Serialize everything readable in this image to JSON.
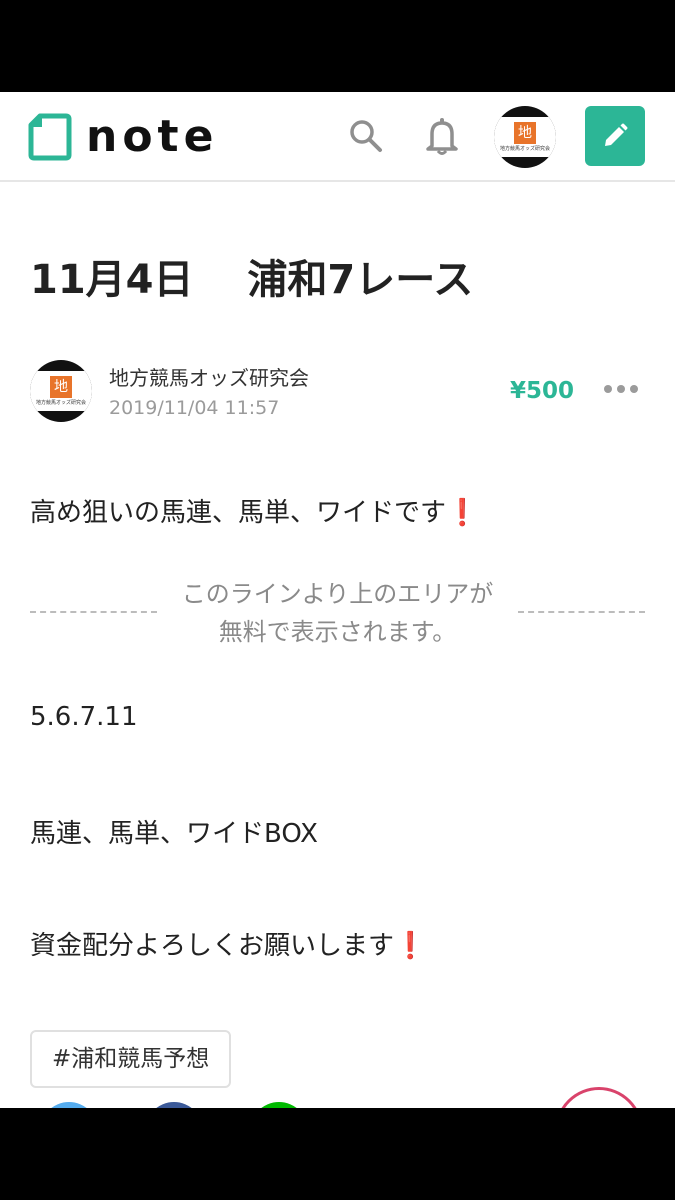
{
  "app": {
    "logo_text": "note",
    "brand_color": "#2cb696"
  },
  "header": {
    "icons": [
      "search-icon",
      "bell-icon",
      "user-avatar",
      "pencil-icon"
    ],
    "avatar_badge": "地",
    "avatar_caption": "地方競馬オッズ研究会"
  },
  "article": {
    "title": "11月4日　 浦和7レース",
    "author": "地方競馬オッズ研究会",
    "date": "2019/11/04 11:57",
    "price": "¥500",
    "intro": "高め狙いの馬連、馬単、ワイドです",
    "free_notice_line1": "このラインより上のエリアが",
    "free_notice_line2": "無料で表示されます。",
    "line1": "5.6.7.11",
    "line2": "馬連、馬単、ワイドBOX",
    "line3": "資金配分よろしくお願いします",
    "exclamation": "❗",
    "hashtag": "#浦和競馬予想"
  },
  "colors": {
    "accent": "#2cb696",
    "exclamation": "#e02020",
    "like": "#d9436b"
  }
}
